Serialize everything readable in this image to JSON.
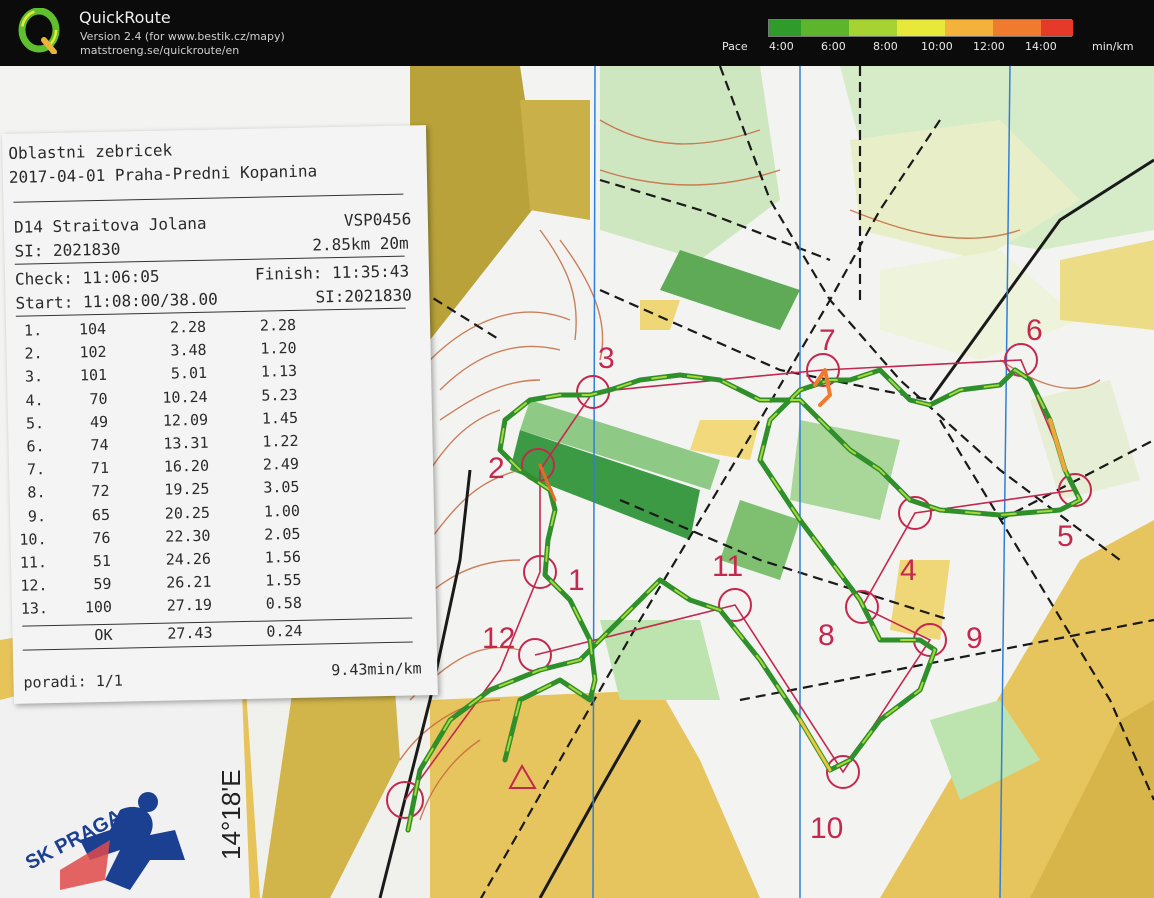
{
  "app": {
    "title": "QuickRoute",
    "version": "Version 2.4  (for www.bestik.cz/mapy)",
    "url": "matstroeng.se/quickroute/en"
  },
  "pace_scale": {
    "label": "Pace",
    "unit": "min/km",
    "ticks": [
      "4:00",
      "6:00",
      "8:00",
      "10:00",
      "12:00",
      "14:00"
    ],
    "colors": [
      "#2e9b2a",
      "#5db52b",
      "#a6d232",
      "#e8e83a",
      "#f5b23a",
      "#f07a2e",
      "#e53a2a"
    ]
  },
  "receipt": {
    "line1": "Oblastni zebricek",
    "line2": "2017-04-01 Praha-Predni Kopanina",
    "name": "D14 Straitova Jolana",
    "club": "VSP0456",
    "si": "SI: 2021830",
    "course": "2.85km 20m",
    "check": "Check: 11:06:05",
    "finish": "Finish: 11:35:43",
    "start": "Start: 11:08:00/38.00",
    "si2": "SI:2021830",
    "splits": [
      {
        "n": "1.",
        "code": "104",
        "cum": "2.28",
        "leg": "2.28"
      },
      {
        "n": "2.",
        "code": "102",
        "cum": "3.48",
        "leg": "1.20"
      },
      {
        "n": "3.",
        "code": "101",
        "cum": "5.01",
        "leg": "1.13"
      },
      {
        "n": "4.",
        "code": "70",
        "cum": "10.24",
        "leg": "5.23"
      },
      {
        "n": "5.",
        "code": "49",
        "cum": "12.09",
        "leg": "1.45"
      },
      {
        "n": "6.",
        "code": "74",
        "cum": "13.31",
        "leg": "1.22"
      },
      {
        "n": "7.",
        "code": "71",
        "cum": "16.20",
        "leg": "2.49"
      },
      {
        "n": "8.",
        "code": "72",
        "cum": "19.25",
        "leg": "3.05"
      },
      {
        "n": "9.",
        "code": "65",
        "cum": "20.25",
        "leg": "1.00"
      },
      {
        "n": "10.",
        "code": "76",
        "cum": "22.30",
        "leg": "2.05"
      },
      {
        "n": "11.",
        "code": "51",
        "cum": "24.26",
        "leg": "1.56"
      },
      {
        "n": "12.",
        "code": "59",
        "cum": "26.21",
        "leg": "1.55"
      },
      {
        "n": "13.",
        "code": "100",
        "cum": "27.19",
        "leg": "0.58"
      }
    ],
    "ok_label": "OK",
    "ok_cum": "27.43",
    "ok_leg": "0.24",
    "rank": "poradi: 1/1",
    "pace": "9.43min/km"
  },
  "map": {
    "coordinate": "14°18'E",
    "club_logo": "SK PRAGA",
    "controls": [
      "1",
      "2",
      "3",
      "4",
      "5",
      "6",
      "7",
      "8",
      "9",
      "10",
      "11",
      "12"
    ]
  }
}
